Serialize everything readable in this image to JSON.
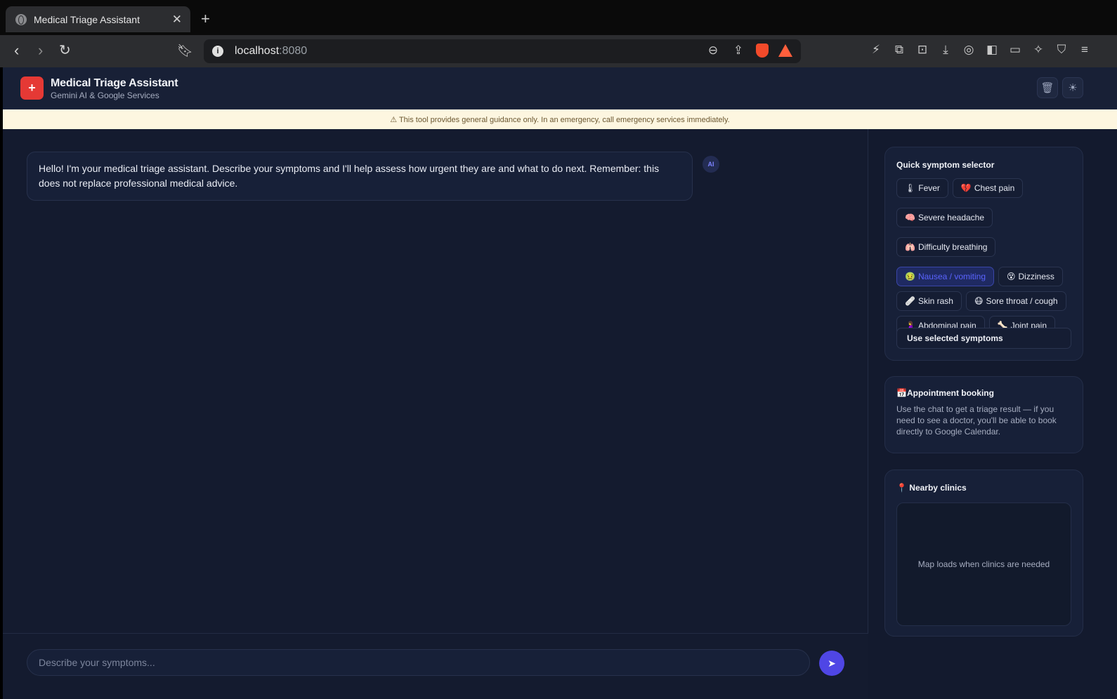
{
  "browser": {
    "tab_title": "Medical Triage Assistant",
    "url_host": "localhost",
    "url_port": ":8080"
  },
  "app": {
    "title": "Medical Triage Assistant",
    "subtitle": "Gemini AI & Google Services",
    "logo_symbol": "+",
    "brand_color": "#e53935",
    "accent_color": "#4f46e5"
  },
  "banner": {
    "text": "⚠ This tool provides general guidance only. In an emergency, call emergency services immediately."
  },
  "chat": {
    "messages": [
      {
        "role": "assistant",
        "badge": "AI",
        "text": "Hello! I'm your medical triage assistant. Describe your symptoms and I'll help assess how urgent they are and what to do next. Remember: this does not replace professional medical advice."
      }
    ],
    "input_placeholder": "Describe your symptoms...",
    "input_value": ""
  },
  "symptom_selector": {
    "title": "Quick symptom selector",
    "chips": [
      {
        "icon": "🌡",
        "label": "Fever",
        "selected": false
      },
      {
        "icon": "💔",
        "label": "Chest pain",
        "selected": false
      },
      {
        "icon": "🧠",
        "label": "Severe headache",
        "selected": false
      },
      {
        "icon": "🫁",
        "label": "Difficulty breathing",
        "selected": false
      },
      {
        "icon": "🤢",
        "label": "Nausea / vomiting",
        "selected": true
      },
      {
        "icon": "😵",
        "label": "Dizziness",
        "selected": false
      },
      {
        "icon": "🩹",
        "label": "Skin rash",
        "selected": false
      },
      {
        "icon": "😷",
        "label": "Sore throat / cough",
        "selected": false
      },
      {
        "icon": "🤰",
        "label": "Abdominal pain",
        "selected": false
      },
      {
        "icon": "🦴",
        "label": "Joint pain",
        "selected": false
      }
    ],
    "use_button": "Use selected symptoms"
  },
  "appointment": {
    "icon": "📅",
    "title": "Appointment booking",
    "text": "Use the chat to get a triage result — if you need to see a doctor, you'll be able to book directly to Google Calendar."
  },
  "clinics": {
    "icon": "📍",
    "title": "Nearby clinics",
    "map_placeholder": "Map loads when clinics are needed"
  }
}
